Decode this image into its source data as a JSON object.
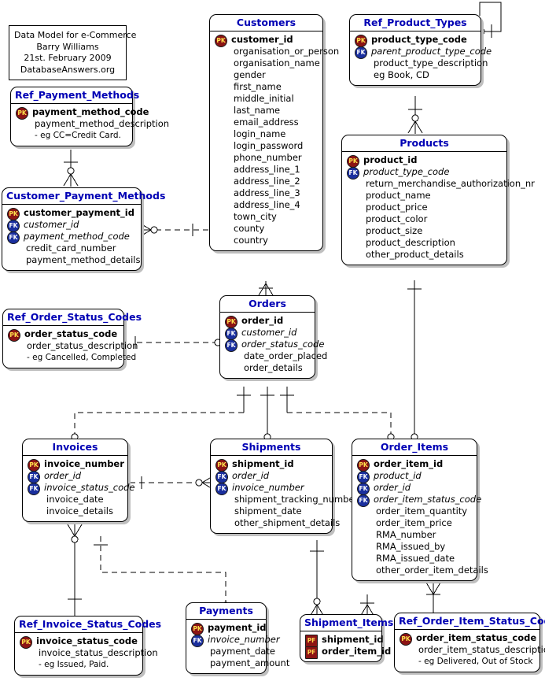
{
  "caption": {
    "lines": [
      "Data Model for e-Commerce",
      "Barry Williams",
      "21st. February 2009",
      "DatabaseAnswers.org"
    ]
  },
  "colors": {
    "entity_title": "#0000b4",
    "pk_badge": "#8c1414",
    "fk_badge": "#1a2f9e",
    "background": "#ffffff",
    "line": "#000000",
    "shadow": "#bfbfbf"
  },
  "badge_labels": {
    "pk": "PK",
    "fk": "FK",
    "pf": "PF"
  },
  "entities": [
    {
      "id": "ref_payment_methods",
      "title": "Ref_Payment_Methods",
      "attributes": [
        {
          "name": "payment_method_code",
          "key": "PK"
        },
        {
          "name": "payment_method_description",
          "key": ""
        },
        {
          "name": "- eg CC=Credit Card.",
          "key": "",
          "note": true
        }
      ]
    },
    {
      "id": "customer_payment_methods",
      "title": "Customer_Payment_Methods",
      "attributes": [
        {
          "name": "customer_payment_id",
          "key": "PK"
        },
        {
          "name": "customer_id",
          "key": "FK"
        },
        {
          "name": "payment_method_code",
          "key": "FK"
        },
        {
          "name": "credit_card_number",
          "key": ""
        },
        {
          "name": "payment_method_details",
          "key": ""
        }
      ]
    },
    {
      "id": "customers",
      "title": "Customers",
      "attributes": [
        {
          "name": "customer_id",
          "key": "PK"
        },
        {
          "name": "organisation_or_person",
          "key": ""
        },
        {
          "name": "organisation_name",
          "key": ""
        },
        {
          "name": "gender",
          "key": ""
        },
        {
          "name": "first_name",
          "key": ""
        },
        {
          "name": "middle_initial",
          "key": ""
        },
        {
          "name": "last_name",
          "key": ""
        },
        {
          "name": "email_address",
          "key": ""
        },
        {
          "name": "login_name",
          "key": ""
        },
        {
          "name": "login_password",
          "key": ""
        },
        {
          "name": "phone_number",
          "key": ""
        },
        {
          "name": "address_line_1",
          "key": ""
        },
        {
          "name": "address_line_2",
          "key": ""
        },
        {
          "name": "address_line_3",
          "key": ""
        },
        {
          "name": "address_line_4",
          "key": ""
        },
        {
          "name": "town_city",
          "key": ""
        },
        {
          "name": "county",
          "key": ""
        },
        {
          "name": "country",
          "key": ""
        }
      ]
    },
    {
      "id": "ref_product_types",
      "title": "Ref_Product_Types",
      "attributes": [
        {
          "name": "product_type_code",
          "key": "PK"
        },
        {
          "name": "parent_product_type_code",
          "key": "FK"
        },
        {
          "name": "product_type_description",
          "key": ""
        },
        {
          "name": "eg Book, CD",
          "key": ""
        }
      ]
    },
    {
      "id": "products",
      "title": "Products",
      "attributes": [
        {
          "name": "product_id",
          "key": "PK"
        },
        {
          "name": "product_type_code",
          "key": "FK"
        },
        {
          "name": "return_merchandise_authorization_nr",
          "key": ""
        },
        {
          "name": "product_name",
          "key": ""
        },
        {
          "name": "product_price",
          "key": ""
        },
        {
          "name": "product_color",
          "key": ""
        },
        {
          "name": "product_size",
          "key": ""
        },
        {
          "name": "product_description",
          "key": ""
        },
        {
          "name": "other_product_details",
          "key": ""
        }
      ]
    },
    {
      "id": "ref_order_status_codes",
      "title": "Ref_Order_Status_Codes",
      "attributes": [
        {
          "name": "order_status_code",
          "key": "PK"
        },
        {
          "name": "order_status_description",
          "key": ""
        },
        {
          "name": "- eg Cancelled, Completed",
          "key": "",
          "note": true
        }
      ]
    },
    {
      "id": "orders",
      "title": "Orders",
      "attributes": [
        {
          "name": "order_id",
          "key": "PK"
        },
        {
          "name": "customer_id",
          "key": "FK"
        },
        {
          "name": "order_status_code",
          "key": "FK"
        },
        {
          "name": "date_order_placed",
          "key": ""
        },
        {
          "name": "order_details",
          "key": ""
        }
      ]
    },
    {
      "id": "invoices",
      "title": "Invoices",
      "attributes": [
        {
          "name": "invoice_number",
          "key": "PK"
        },
        {
          "name": "order_id",
          "key": "FK"
        },
        {
          "name": "invoice_status_code",
          "key": "FK"
        },
        {
          "name": "invoice_date",
          "key": ""
        },
        {
          "name": "invoice_details",
          "key": ""
        }
      ]
    },
    {
      "id": "shipments",
      "title": "Shipments",
      "attributes": [
        {
          "name": "shipment_id",
          "key": "PK"
        },
        {
          "name": "order_id",
          "key": "FK"
        },
        {
          "name": "invoice_number",
          "key": "FK"
        },
        {
          "name": "shipment_tracking_number",
          "key": ""
        },
        {
          "name": "shipment_date",
          "key": ""
        },
        {
          "name": "other_shipment_details",
          "key": ""
        }
      ]
    },
    {
      "id": "order_items",
      "title": "Order_Items",
      "attributes": [
        {
          "name": "order_item_id",
          "key": "PK"
        },
        {
          "name": "product_id",
          "key": "FK"
        },
        {
          "name": "order_id",
          "key": "FK"
        },
        {
          "name": "order_item_status_code",
          "key": "FK"
        },
        {
          "name": "order_item_quantity",
          "key": ""
        },
        {
          "name": "order_item_price",
          "key": ""
        },
        {
          "name": "RMA_number",
          "key": ""
        },
        {
          "name": "RMA_issued_by",
          "key": ""
        },
        {
          "name": "RMA_issued_date",
          "key": ""
        },
        {
          "name": "other_order_item_details",
          "key": ""
        }
      ]
    },
    {
      "id": "ref_invoice_status_codes",
      "title": "Ref_Invoice_Status_Codes",
      "attributes": [
        {
          "name": "invoice_status_code",
          "key": "PK"
        },
        {
          "name": "invoice_status_description",
          "key": ""
        },
        {
          "name": "- eg Issued, Paid.",
          "key": "",
          "note": true
        }
      ]
    },
    {
      "id": "payments",
      "title": "Payments",
      "attributes": [
        {
          "name": "payment_id",
          "key": "PK"
        },
        {
          "name": "invoice_number",
          "key": "FK"
        },
        {
          "name": "payment_date",
          "key": ""
        },
        {
          "name": "payment_amount",
          "key": ""
        }
      ]
    },
    {
      "id": "shipment_items",
      "title": "Shipment_Items",
      "attributes": [
        {
          "name": "shipment_id",
          "key": "PF"
        },
        {
          "name": "order_item_id",
          "key": "PF"
        }
      ]
    },
    {
      "id": "ref_order_item_status_codes",
      "title": "Ref_Order_Item_Status_Codes",
      "attributes": [
        {
          "name": "order_item_status_code",
          "key": "PK"
        },
        {
          "name": "order_item_status_description",
          "key": ""
        },
        {
          "name": "- eg Delivered, Out of Stock",
          "key": "",
          "note": true
        }
      ]
    }
  ],
  "relationships": [
    {
      "from": "Ref_Payment_Methods",
      "to": "Customer_Payment_Methods",
      "from_card": "one",
      "to_card": "zero-or-many"
    },
    {
      "from": "Customers",
      "to": "Customer_Payment_Methods",
      "from_card": "one",
      "to_card": "zero-or-many"
    },
    {
      "from": "Ref_Product_Types",
      "to": "Ref_Product_Types",
      "from_card": "one",
      "to_card": "zero-or-many"
    },
    {
      "from": "Ref_Product_Types",
      "to": "Products",
      "from_card": "one",
      "to_card": "zero-or-many"
    },
    {
      "from": "Customers",
      "to": "Orders",
      "from_card": "one",
      "to_card": "zero-or-many"
    },
    {
      "from": "Ref_Order_Status_Codes",
      "to": "Orders",
      "from_card": "one",
      "to_card": "zero-or-many"
    },
    {
      "from": "Orders",
      "to": "Invoices",
      "from_card": "one",
      "to_card": "zero-or-many"
    },
    {
      "from": "Orders",
      "to": "Shipments",
      "from_card": "one",
      "to_card": "zero-or-many"
    },
    {
      "from": "Orders",
      "to": "Order_Items",
      "from_card": "one",
      "to_card": "zero-or-many"
    },
    {
      "from": "Products",
      "to": "Order_Items",
      "from_card": "one",
      "to_card": "zero-or-many"
    },
    {
      "from": "Invoices",
      "to": "Shipments",
      "from_card": "one",
      "to_card": "zero-or-many"
    },
    {
      "from": "Invoices",
      "to": "Payments",
      "from_card": "one",
      "to_card": "zero-or-many"
    },
    {
      "from": "Ref_Invoice_Status_Codes",
      "to": "Invoices",
      "from_card": "one",
      "to_card": "zero-or-many"
    },
    {
      "from": "Shipments",
      "to": "Shipment_Items",
      "from_card": "one",
      "to_card": "zero-or-many"
    },
    {
      "from": "Order_Items",
      "to": "Shipment_Items",
      "from_card": "one",
      "to_card": "one-or-many"
    },
    {
      "from": "Ref_Order_Item_Status_Codes",
      "to": "Order_Items",
      "from_card": "one",
      "to_card": "zero-or-many"
    }
  ]
}
